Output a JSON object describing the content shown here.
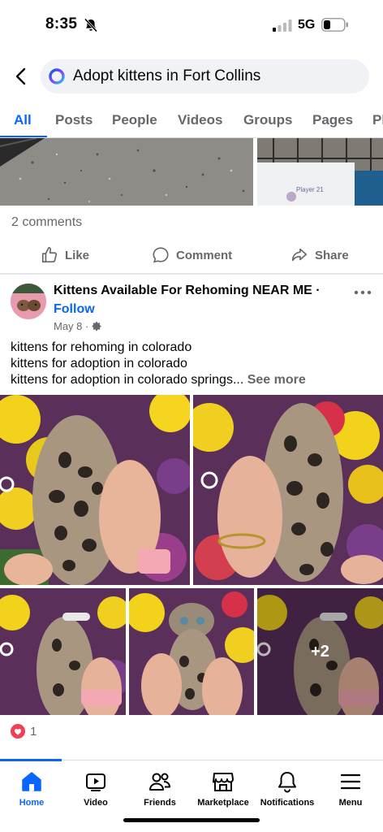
{
  "status_bar": {
    "time": "8:35",
    "network": "5G"
  },
  "search": {
    "query": "Adopt kittens in Fort Collins"
  },
  "tabs": [
    {
      "label": "All"
    },
    {
      "label": "Posts"
    },
    {
      "label": "People"
    },
    {
      "label": "Videos"
    },
    {
      "label": "Groups"
    },
    {
      "label": "Pages"
    },
    {
      "label": "Pl"
    }
  ],
  "prev_post": {
    "comments": "2 comments",
    "sign_text": "Player 21"
  },
  "actions": {
    "like": "Like",
    "comment": "Comment",
    "share": "Share"
  },
  "post": {
    "author": "Kittens Available For Rehoming NEAR ME ·",
    "follow": "Follow",
    "date": "May 8 ·",
    "lines": [
      "kittens for rehoming in colorado",
      "kittens for adoption in colorado",
      "kittens for adoption in colorado springs..."
    ],
    "see_more": "See more",
    "more_photos": "+2",
    "reaction_count": "1"
  },
  "nav": [
    {
      "label": "Home",
      "icon": "home-icon"
    },
    {
      "label": "Video",
      "icon": "video-icon"
    },
    {
      "label": "Friends",
      "icon": "friends-icon"
    },
    {
      "label": "Marketplace",
      "icon": "marketplace-icon"
    },
    {
      "label": "Notifications",
      "icon": "bell-icon"
    },
    {
      "label": "Menu",
      "icon": "menu-icon"
    }
  ],
  "colors": {
    "accent": "#0866ff",
    "muted": "#65676b",
    "love": "#f33e58"
  }
}
